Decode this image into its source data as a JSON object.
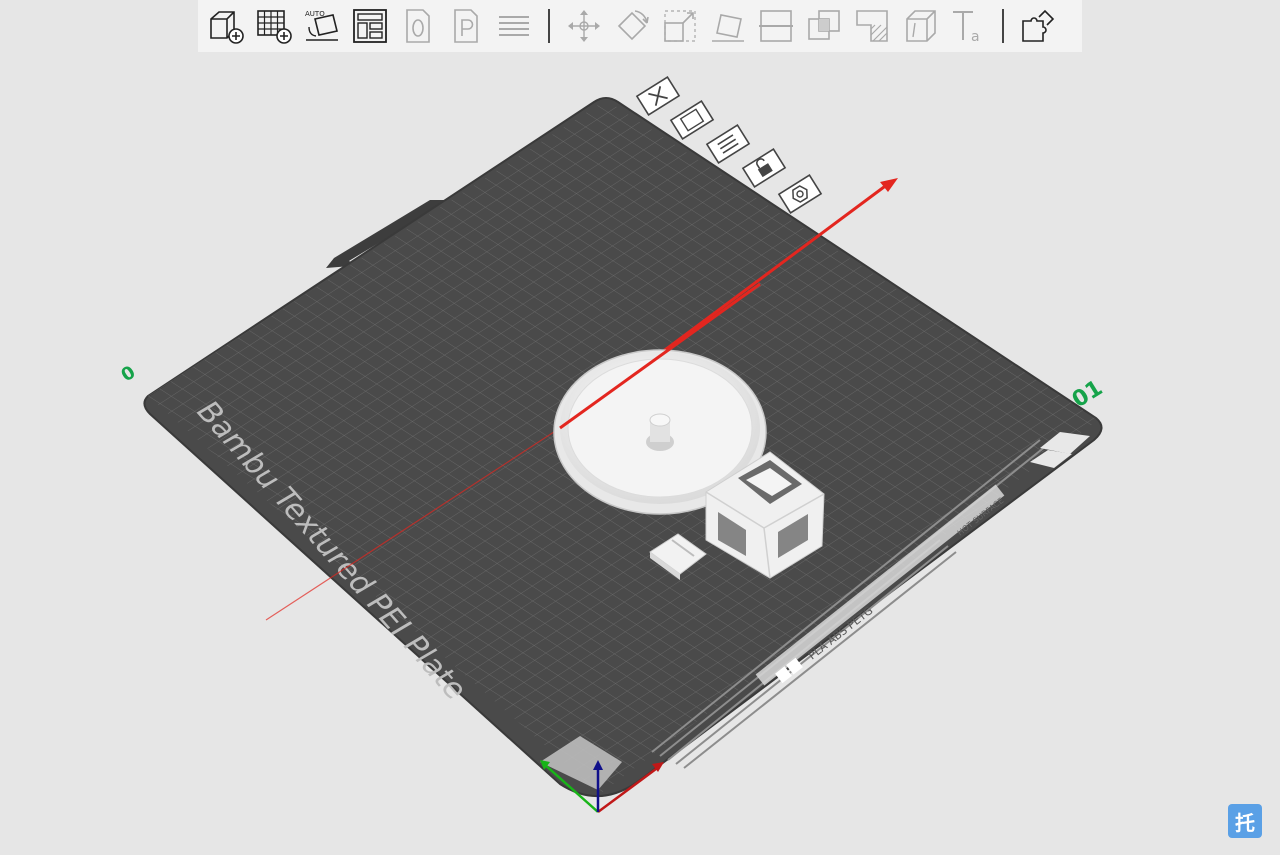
{
  "toolbar": {
    "buttons": [
      {
        "id": "add-object",
        "icon": "cube-plus-icon"
      },
      {
        "id": "add-plate",
        "icon": "grid-plus-icon"
      },
      {
        "id": "auto-orient",
        "icon": "auto-orient-icon",
        "label": "AUTO"
      },
      {
        "id": "arrange",
        "icon": "arrange-icon"
      },
      {
        "id": "split-objects",
        "icon": "split-objects-icon"
      },
      {
        "id": "split-parts",
        "icon": "split-parts-icon"
      },
      {
        "id": "layers",
        "icon": "layers-icon"
      },
      {
        "id": "move",
        "icon": "move-icon"
      },
      {
        "id": "rotate",
        "icon": "rotate-icon"
      },
      {
        "id": "scale",
        "icon": "scale-icon"
      },
      {
        "id": "lay-on-face",
        "icon": "lay-on-face-icon"
      },
      {
        "id": "cut",
        "icon": "cut-icon"
      },
      {
        "id": "boolean",
        "icon": "boolean-icon"
      },
      {
        "id": "support-paint",
        "icon": "support-paint-icon"
      },
      {
        "id": "seam-paint",
        "icon": "seam-paint-icon"
      },
      {
        "id": "text",
        "icon": "text-icon"
      },
      {
        "id": "assembly",
        "icon": "puzzle-icon"
      }
    ]
  },
  "plate": {
    "label": "Bambu Textured PEI Plate",
    "plate_number": "01",
    "side_mark": "0",
    "surface_text": "PLA ABS PETG",
    "hot_surface_label": "HOT SURFACE"
  },
  "plate_buttons": [
    {
      "id": "delete-plate",
      "icon": "close-icon"
    },
    {
      "id": "arrange-plate",
      "icon": "arrange-icon"
    },
    {
      "id": "orient-plate",
      "icon": "layers-icon"
    },
    {
      "id": "lock-plate",
      "icon": "lock-icon"
    },
    {
      "id": "plate-settings",
      "icon": "gear-icon"
    }
  ],
  "colors": {
    "background": "#e6e6e6",
    "plate": "#4a4a4a",
    "grid": "#6f6f6f",
    "x_axis": "#e3261f",
    "y_axis": "#18b418",
    "z_axis": "#10108a",
    "plate_number": "#16a34a",
    "badge": "#5aa0e6"
  },
  "badge": {
    "text": "托"
  }
}
